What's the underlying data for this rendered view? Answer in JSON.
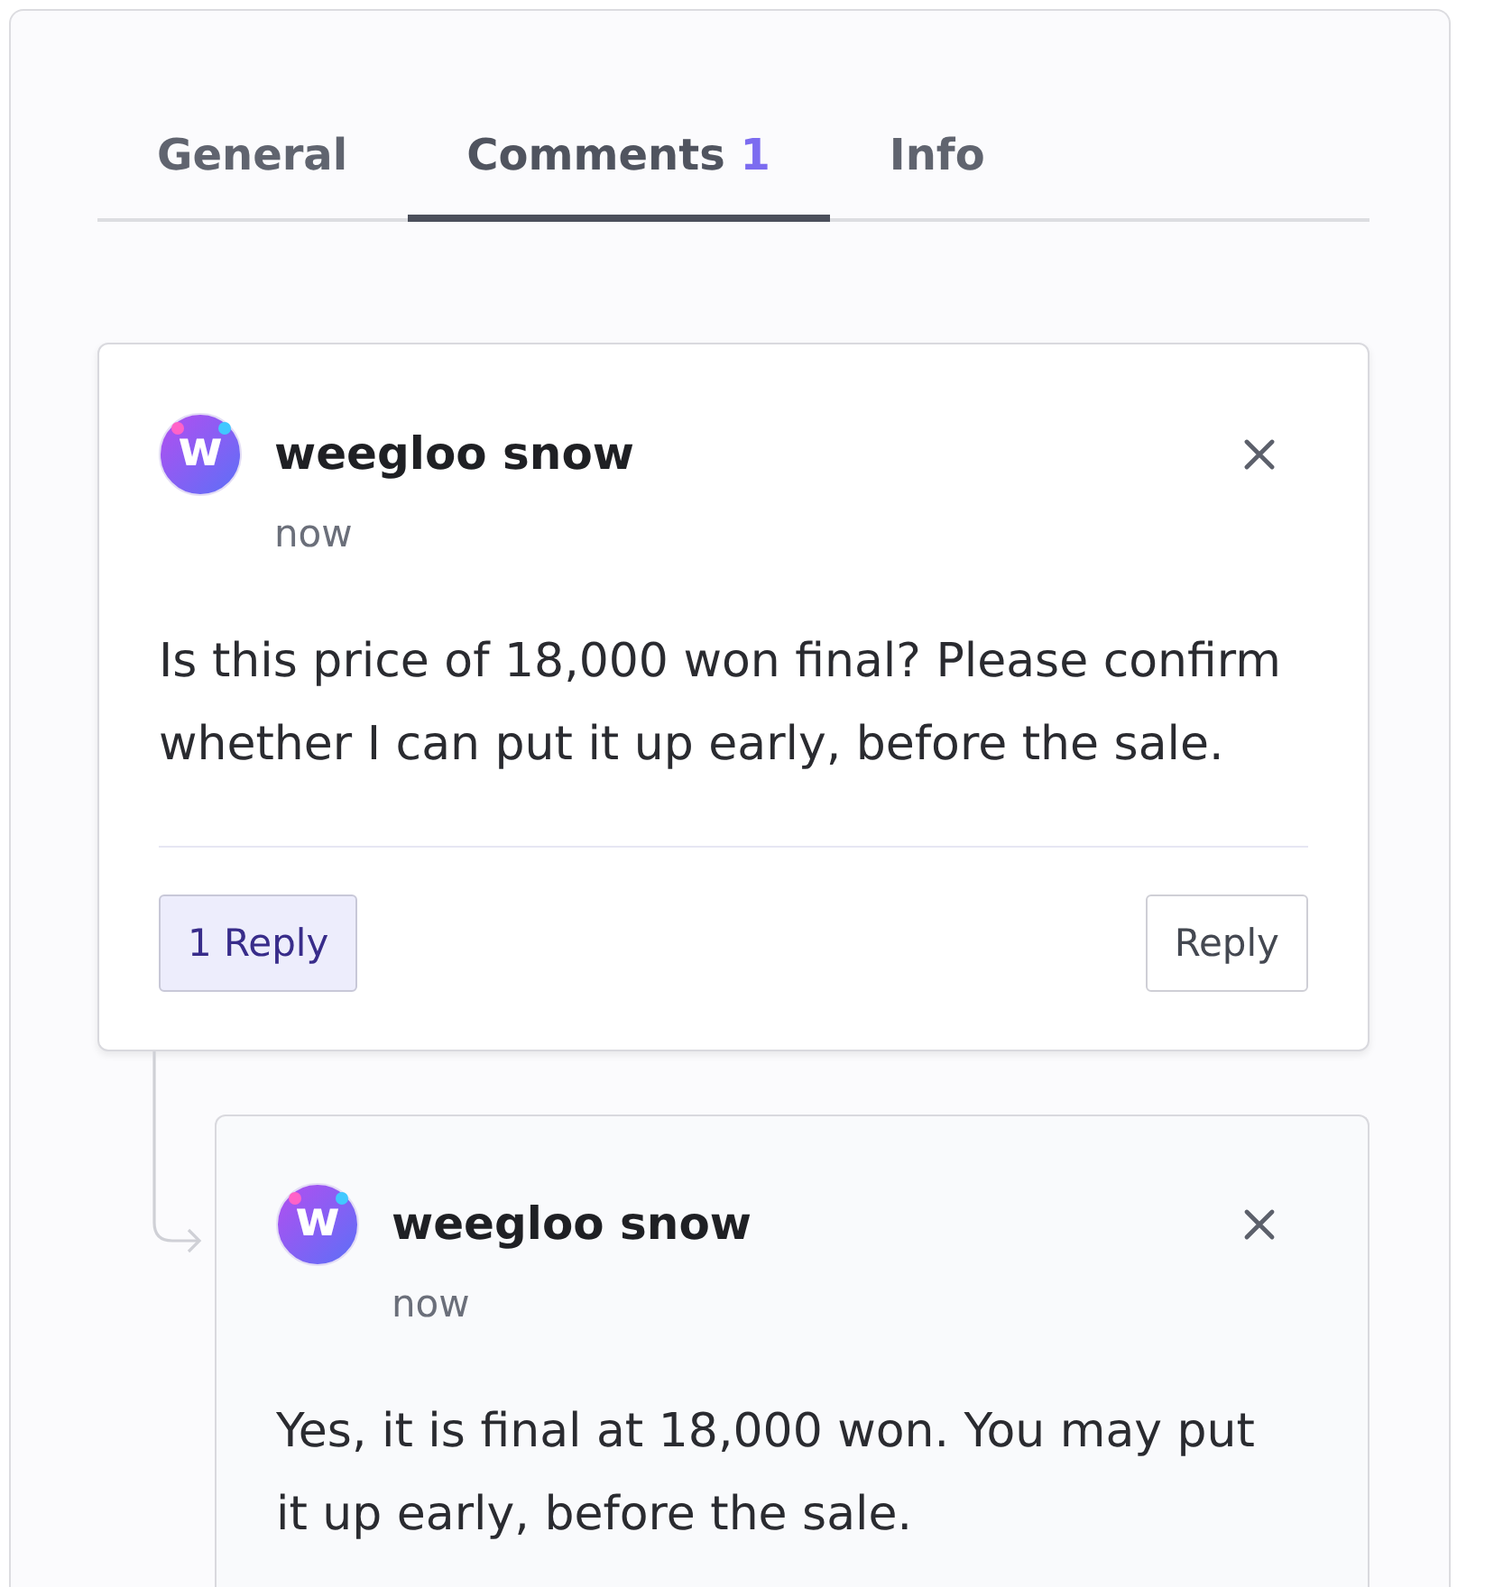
{
  "tabs": [
    {
      "label": "General",
      "selected": false
    },
    {
      "label": "Comments",
      "count": "1",
      "selected": true
    },
    {
      "label": "Info",
      "selected": false
    }
  ],
  "comments": [
    {
      "avatar": "w",
      "author": "weegloo snow",
      "time": "now",
      "text": "Is this price of 18,000 won final? Please confirm whether I can put it up early, before the sale.",
      "replies_button": "1 Reply",
      "reply_button": "Reply",
      "replies": [
        {
          "avatar": "w",
          "author": "weegloo snow",
          "time": "now",
          "text": "Yes, it is final at 18,000 won. You may put it up early, before the sale."
        }
      ]
    }
  ]
}
